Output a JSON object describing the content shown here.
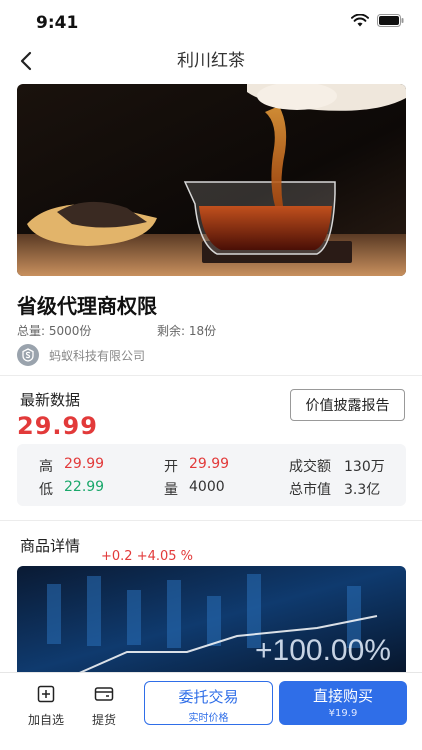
{
  "status_bar": {
    "time": "9:41",
    "wifi_icon": "wifi-icon",
    "battery_icon": "battery-icon"
  },
  "nav": {
    "title": "利川红茶",
    "back_icon": "chevron-left-icon"
  },
  "hero": {
    "description_icon": "tea-photo"
  },
  "product": {
    "title": "省级代理商权限",
    "total_label": "总量: 5000份",
    "remaining_label": "剩余: 18份",
    "company": "蚂蚁科技有限公司"
  },
  "latest": {
    "label": "最新数据",
    "price": "29.99",
    "report_button": "价值披露报告"
  },
  "stats": {
    "high_label": "高",
    "high_value": "29.99",
    "low_label": "低",
    "low_value": "22.99",
    "open_label": "开",
    "open_value": "29.99",
    "volume_label": "量",
    "volume_value": "4000",
    "turnover_label": "成交额",
    "turnover_value": "130万",
    "market_cap_label": "总市值",
    "market_cap_value": "3.3亿"
  },
  "detail": {
    "label": "商品详情",
    "delta": "+0.2 +4.05 %",
    "overlay_text": "+100.00%"
  },
  "bottom": {
    "watchlist_label": "加自选",
    "pickup_label": "提货",
    "entrust_label": "委托交易",
    "entrust_sub": "实时价格",
    "buy_label": "直接购买",
    "buy_sub": "¥19.9"
  },
  "colors": {
    "accent_blue": "#2f6ee8",
    "price_red": "#e23a3a",
    "price_green": "#1aa86b"
  }
}
